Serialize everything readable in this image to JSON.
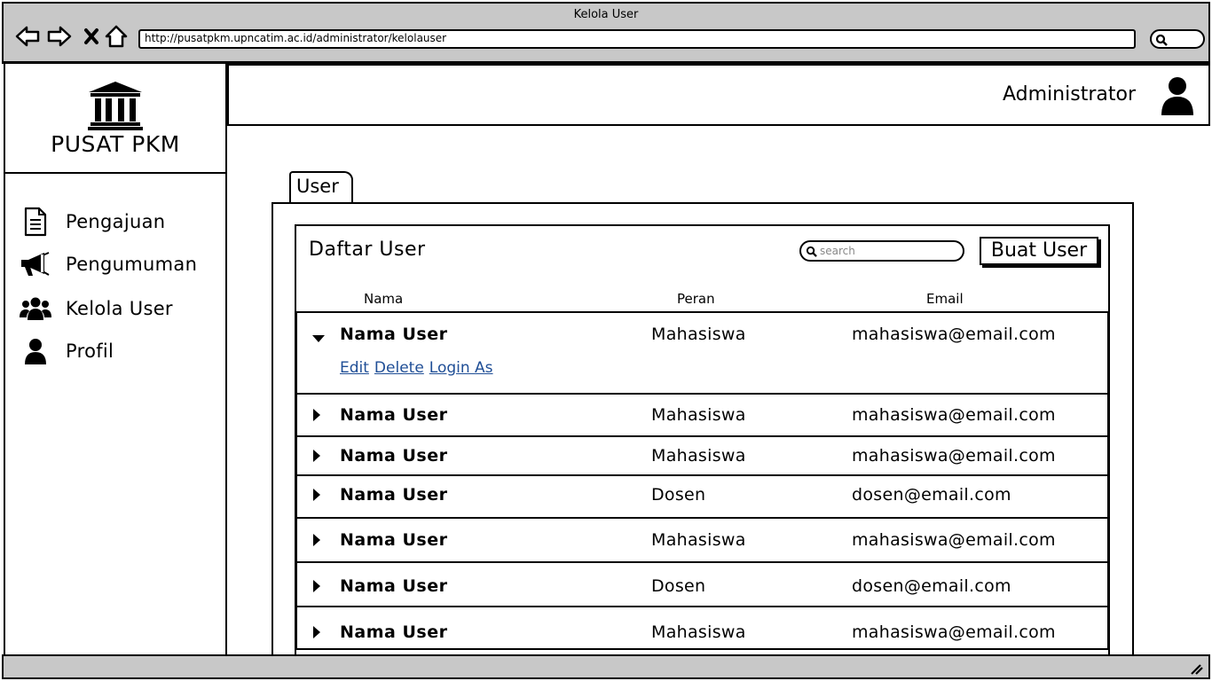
{
  "window": {
    "title": "Kelola User",
    "url": "http://pusatpkm.upncatim.ac.id/administrator/kelolauser"
  },
  "sidebar": {
    "brand": "PUSAT PKM",
    "items": [
      {
        "label": "Pengajuan",
        "icon": "document-icon"
      },
      {
        "label": "Pengumuman",
        "icon": "megaphone-icon"
      },
      {
        "label": "Kelola User",
        "icon": "users-icon"
      },
      {
        "label": "Profil",
        "icon": "user-icon"
      }
    ]
  },
  "header": {
    "user_name": "Administrator"
  },
  "tab": {
    "label": "User"
  },
  "list": {
    "title": "Daftar User",
    "search_placeholder": "search",
    "create_button": "Buat User",
    "columns": [
      "Nama",
      "Peran",
      "Email"
    ],
    "expanded_actions": [
      "Edit",
      "Delete",
      "Login As"
    ],
    "rows": [
      {
        "name": "Nama User",
        "role": "Mahasiswa",
        "email": "mahasiswa@email.com",
        "expanded": true
      },
      {
        "name": "Nama User",
        "role": "Mahasiswa",
        "email": "mahasiswa@email.com",
        "expanded": false
      },
      {
        "name": "Nama User",
        "role": "Mahasiswa",
        "email": "mahasiswa@email.com",
        "expanded": false
      },
      {
        "name": "Nama User",
        "role": "Dosen",
        "email": "dosen@email.com",
        "expanded": false
      },
      {
        "name": "Nama User",
        "role": "Mahasiswa",
        "email": "mahasiswa@email.com",
        "expanded": false
      },
      {
        "name": "Nama User",
        "role": "Dosen",
        "email": "dosen@email.com",
        "expanded": false
      },
      {
        "name": "Nama User",
        "role": "Mahasiswa",
        "email": "mahasiswa@email.com",
        "expanded": false
      }
    ]
  }
}
